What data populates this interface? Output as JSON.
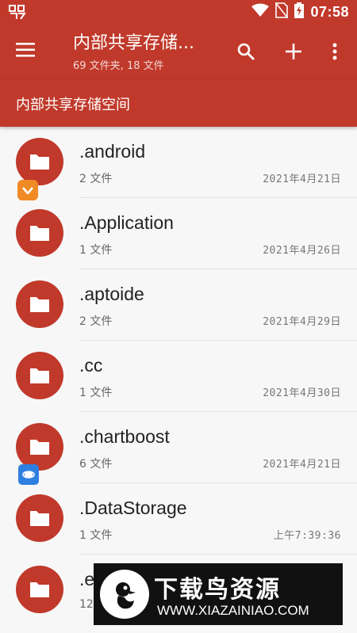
{
  "theme": {
    "primary": "#c0392b",
    "background": "#f7f7f7"
  },
  "status_bar": {
    "time": "07:58",
    "left_icon": "bug-icon",
    "icons": [
      "wifi-icon",
      "no-sim-icon",
      "battery-charging-icon"
    ]
  },
  "app_bar": {
    "title": "内部共享存储...",
    "subtitle": "69 文件夹, 18 文件",
    "actions": [
      "search-icon",
      "add-icon",
      "more-vert-icon"
    ]
  },
  "breadcrumb": {
    "label": "内部共享存储空间"
  },
  "files": [
    {
      "name": ".android",
      "count": "2",
      "unit": "文件",
      "date": "2021年4月21日"
    },
    {
      "name": ".Application",
      "count": "1",
      "unit": "文件",
      "date": "2021年4月26日"
    },
    {
      "name": ".aptoide",
      "count": "2",
      "unit": "文件",
      "date": "2021年4月29日"
    },
    {
      "name": ".cc",
      "count": "1",
      "unit": "文件",
      "date": "2021年4月30日"
    },
    {
      "name": ".chartboost",
      "count": "6",
      "unit": "文件",
      "date": "2021年4月21日"
    },
    {
      "name": ".DataStorage",
      "count": "1",
      "unit": "文件",
      "date": "上午7:39:36"
    },
    {
      "name": ".e",
      "count": "12",
      "unit": "",
      "date": ""
    }
  ],
  "watermark": {
    "title": "下载鸟资源",
    "url": "WWW.XIAZAINIAO.COM"
  }
}
